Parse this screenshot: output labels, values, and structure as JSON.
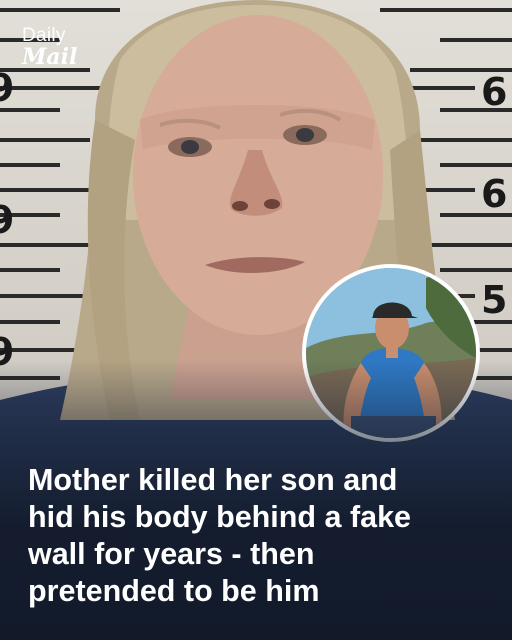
{
  "logo": {
    "line1": "Daily",
    "line2": "Mail"
  },
  "chart_numbers": {
    "n1": "6",
    "n2": "6",
    "n3": "5",
    "left1": "9",
    "left2": "9",
    "left3": "9"
  },
  "headline": {
    "lines": [
      "Mother killed her son and",
      "hid his body behind a fake",
      "wall for years - then",
      "pretended to be him"
    ]
  },
  "colors": {
    "background_dark": "#121a2a",
    "text": "#ffffff",
    "chart": "#d8d4cc"
  }
}
